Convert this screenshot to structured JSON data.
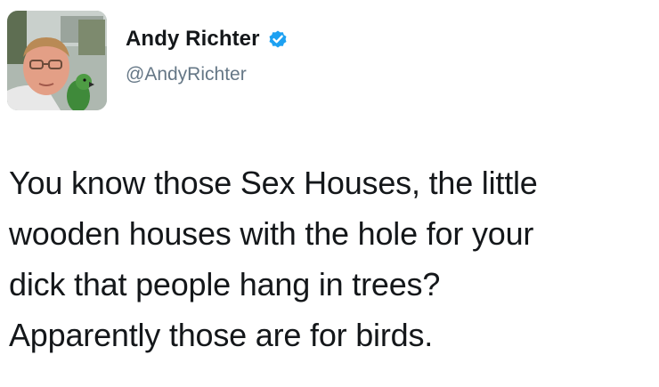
{
  "author": {
    "display_name": "Andy Richter",
    "handle": "@AndyRichter",
    "verified_icon": "verified-badge-icon",
    "verified_color": "#1da1f2",
    "avatar": "avatar-photo"
  },
  "tweet": {
    "lines": [
      "You know those Sex Houses, the little",
      "wooden houses with the hole for your",
      "dick that people hang in trees?",
      "Apparently those are for birds."
    ]
  }
}
